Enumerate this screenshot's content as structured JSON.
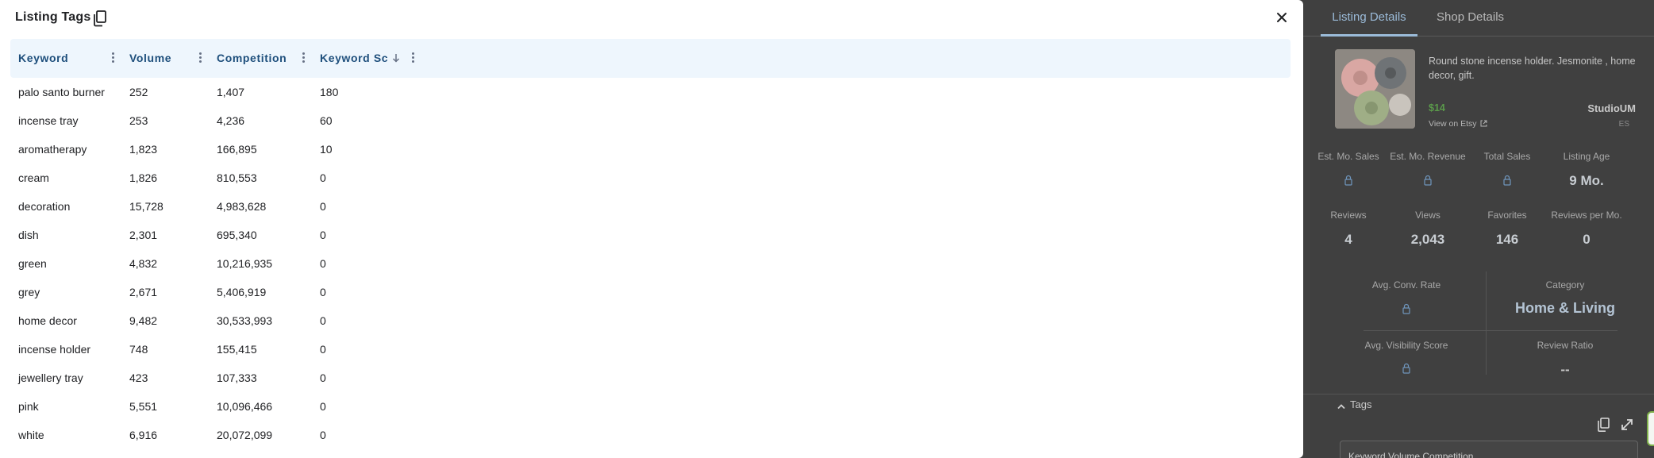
{
  "modal": {
    "title": "Listing Tags",
    "copy_icon": "copy-icon",
    "close_icon": "close-icon"
  },
  "table": {
    "headers": [
      "Keyword",
      "Volume",
      "Competition",
      "Keyword Sc"
    ],
    "rows": [
      [
        "palo santo burner",
        "252",
        "1,407",
        "180"
      ],
      [
        "incense tray",
        "253",
        "4,236",
        "60"
      ],
      [
        "aromatherapy",
        "1,823",
        "166,895",
        "10"
      ],
      [
        "cream",
        "1,826",
        "810,553",
        "0"
      ],
      [
        "decoration",
        "15,728",
        "4,983,628",
        "0"
      ],
      [
        "dish",
        "2,301",
        "695,340",
        "0"
      ],
      [
        "green",
        "4,832",
        "10,216,935",
        "0"
      ],
      [
        "grey",
        "2,671",
        "5,406,919",
        "0"
      ],
      [
        "home decor",
        "9,482",
        "30,533,993",
        "0"
      ],
      [
        "incense holder",
        "748",
        "155,415",
        "0"
      ],
      [
        "jewellery tray",
        "423",
        "107,333",
        "0"
      ],
      [
        "pink",
        "5,551",
        "10,096,466",
        "0"
      ],
      [
        "white",
        "6,916",
        "20,072,099",
        "0"
      ]
    ]
  },
  "side": {
    "tabs": [
      "Listing Details",
      "Shop Details"
    ],
    "product": {
      "description": "Round stone incense holder. Jesmonite , home decor, gift.",
      "price": "$14",
      "view_link": "View on Etsy",
      "shop": "StudioUM",
      "country": "ES"
    },
    "stats_row1": [
      {
        "label": "Est. Mo. Sales",
        "value": null
      },
      {
        "label": "Est. Mo. Revenue",
        "value": null
      },
      {
        "label": "Total Sales",
        "value": null
      },
      {
        "label": "Listing Age",
        "value": "9 Mo."
      }
    ],
    "stats_row2": [
      {
        "label": "Reviews",
        "value": "4"
      },
      {
        "label": "Views",
        "value": "2,043"
      },
      {
        "label": "Favorites",
        "value": "146"
      },
      {
        "label": "Reviews per Mo.",
        "value": "0"
      }
    ],
    "grid": {
      "conv_label": "Avg. Conv. Rate",
      "category_label": "Category",
      "category_value": "Home & Living",
      "visibility_label": "Avg. Visibility Score",
      "review_ratio_label": "Review Ratio",
      "review_ratio_value": "--"
    },
    "tags": {
      "label": "Tags",
      "card_text": "Keyword                    Volume          Competition"
    }
  },
  "colors": {
    "header_bg": "#eef6fd",
    "header_text": "#1e4f7c",
    "accent_tab": "#9bbbd9",
    "price": "#5a9a4a"
  }
}
